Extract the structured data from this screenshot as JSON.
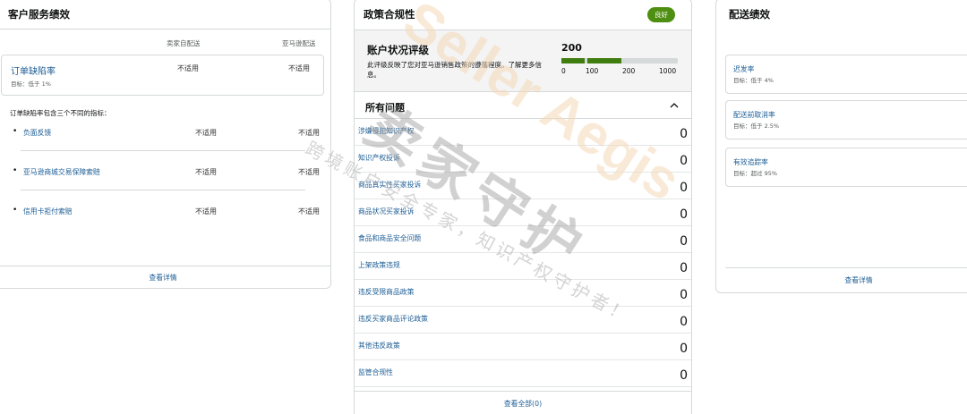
{
  "customer_service": {
    "title": "客户服务绩效",
    "col_seller": "卖家自配送",
    "col_amazon": "亚马逊配送",
    "odr_label": "订单缺陷率",
    "odr_target": "目标：低于 1%",
    "odr_seller": "不适用",
    "odr_amazon": "不适用",
    "note": "订单缺陷率包含三个不同的指标：",
    "sub_metrics": [
      {
        "bullet": "•",
        "label": "负面反馈",
        "seller": "不适用",
        "amazon": "不适用"
      },
      {
        "bullet": "•",
        "label": "亚马逊商城交易保障索赔",
        "seller": "不适用",
        "amazon": "不适用"
      },
      {
        "bullet": "•",
        "label": "信用卡拒付索赔",
        "seller": "不适用",
        "amazon": "不适用"
      }
    ],
    "footer_link": "查看详情"
  },
  "policy": {
    "title": "政策合规性",
    "badge": "良好",
    "ahr_title": "账户状况评级",
    "ahr_desc": "此评级反映了您对亚马逊销售政策的遵循程度。了解更多信息。",
    "ahr_score": "200",
    "ahr_score_value": 200,
    "ahr_ticks": [
      "0",
      "100",
      "200",
      "1000"
    ],
    "issues_title": "所有问题",
    "issues": [
      {
        "label": "涉嫌侵犯知识产权",
        "count": "0"
      },
      {
        "label": "知识产权投诉",
        "count": "0"
      },
      {
        "label": "商品真实性买家投诉",
        "count": "0"
      },
      {
        "label": "商品状况买家投诉",
        "count": "0"
      },
      {
        "label": "食品和商品安全问题",
        "count": "0"
      },
      {
        "label": "上架政策违规",
        "count": "0"
      },
      {
        "label": "违反受限商品政策",
        "count": "0"
      },
      {
        "label": "违反买家商品评论政策",
        "count": "0"
      },
      {
        "label": "其他违反政策",
        "count": "0"
      },
      {
        "label": "监管合规性",
        "count": "0"
      }
    ],
    "footer_link": "查看全部(0)"
  },
  "shipping": {
    "title": "配送绩效",
    "metrics": [
      {
        "label": "迟发率",
        "goal": "目标：低于 4%"
      },
      {
        "label": "配送前取消率",
        "goal": "目标：低于 2.5%"
      },
      {
        "label": "有效追踪率",
        "goal": "目标：超过 95%"
      }
    ],
    "footer_link": "查看详情"
  },
  "watermark": {
    "brand": "Seller Aegis",
    "brand_cn": "卖家守护",
    "slogan": "跨境账户安全专家，知识产权守护者！"
  },
  "colors": {
    "link": "#1b5c94",
    "good_green": "#4e8e11",
    "bar_green": "#3f7d10",
    "border": "#d5d9d9"
  }
}
